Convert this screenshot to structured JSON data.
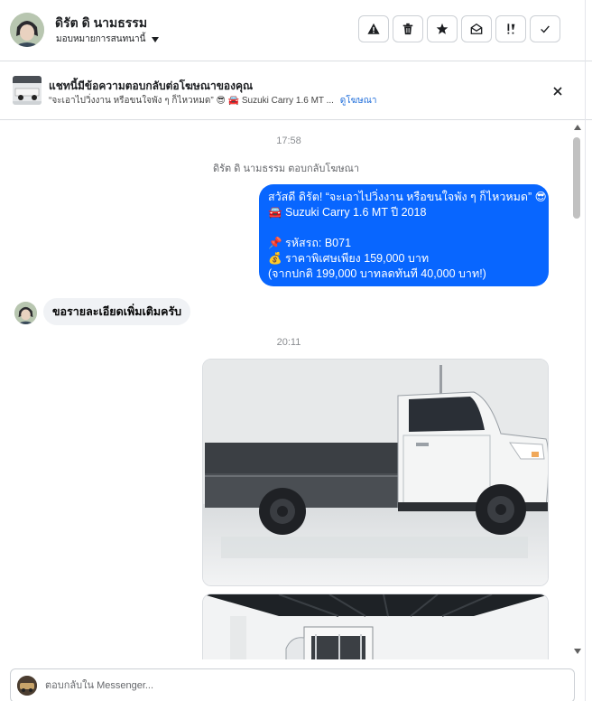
{
  "header": {
    "contact_name": "ดิรัต ดิ นามธรรม",
    "assign_label": "มอบหมายการสนทนานี้",
    "actions": [
      {
        "icon": "warning-icon",
        "name": "mark-spam-button"
      },
      {
        "icon": "trash-icon",
        "name": "delete-button"
      },
      {
        "icon": "star-icon",
        "name": "star-button"
      },
      {
        "icon": "envelope-open-icon",
        "name": "mark-unread-button"
      },
      {
        "icon": "follow-up-icon",
        "name": "follow-up-button"
      },
      {
        "icon": "check-icon",
        "name": "mark-done-button"
      }
    ]
  },
  "banner": {
    "title": "แชทนี้มีข้อความตอบกลับต่อโฆษณาของคุณ",
    "subtitle": "“จะเอาไปวิ่งงาน หรือขนใจพัง ๆ ก็ไหวหมด” 😎 🚘 Suzuki Carry 1.6 MT ...",
    "view_ad_link": "ดูโฆษณา"
  },
  "conversation": {
    "time_1": "17:58",
    "reply_note": "ดิรัต ดิ นามธรรม ตอบกลับโฆษณา",
    "outgoing_lines": [
      "สวัสดี ดิรัต! “จะเอาไปวิ่งงาน หรือขนใจพัง ๆ ก็ไหวหมด” 😎",
      "🚘 Suzuki Carry 1.6 MT ปี 2018",
      "",
      "📌 รหัสรถ: B071",
      "💰 ราคาพิเศษเพียง 159,000 บาท",
      "(จากปกติ 199,000 บาทลดทันที 40,000 บาท!)"
    ],
    "incoming_message": "ขอรายละเอียดเพิ่มเติมครับ",
    "time_2": "20:11"
  },
  "composer": {
    "placeholder": "ตอบกลับใน Messenger..."
  },
  "colors": {
    "accent": "#0866ff",
    "incoming_bubble": "#f0f2f5",
    "link": "#216fdb"
  }
}
